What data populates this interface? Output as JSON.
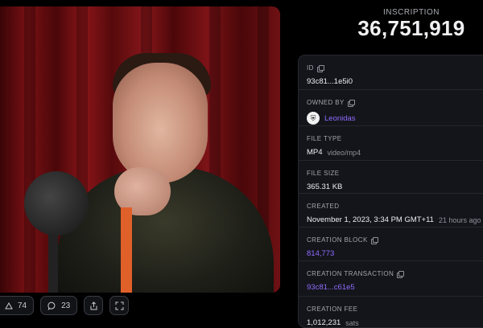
{
  "header": {
    "label": "INSCRIPTION",
    "number": "36,751,919"
  },
  "media": {
    "image": "video-still-person-at-microphone"
  },
  "actions": {
    "likes_count": "74",
    "comments_count": "23",
    "like_icon": "triangle-up-icon",
    "comment_icon": "comment-icon",
    "share_icon": "share-icon",
    "fullscreen_icon": "fullscreen-icon"
  },
  "details": {
    "id": {
      "label": "ID",
      "value": "93c81...1e5i0"
    },
    "owned_by": {
      "label": "OWNED BY",
      "value": "Leonidas"
    },
    "file_type": {
      "label": "FILE TYPE",
      "value": "MP4",
      "mime": "video/mp4"
    },
    "file_size": {
      "label": "FILE SIZE",
      "value": "365.31 KB"
    },
    "created": {
      "label": "CREATED",
      "value": "November 1, 2023, 3:34 PM GMT+11",
      "relative": "21 hours ago"
    },
    "creation_block": {
      "label": "CREATION BLOCK",
      "value": "814,773"
    },
    "creation_transaction": {
      "label": "CREATION TRANSACTION",
      "value": "93c81...c61e5"
    },
    "creation_fee": {
      "label": "CREATION FEE",
      "value": "1,012,231",
      "unit": "sats"
    }
  },
  "colors": {
    "background": "#000000",
    "panel": "#14151a",
    "link": "#8f6bff",
    "muted": "#a3a5ae"
  }
}
